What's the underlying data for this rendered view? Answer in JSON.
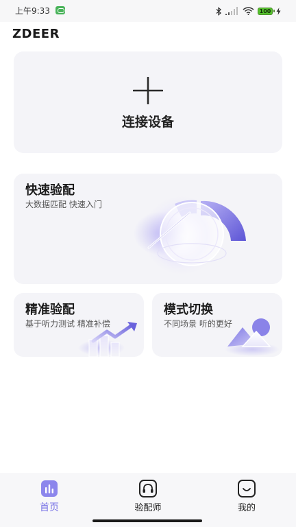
{
  "status_bar": {
    "time": "上午9:33",
    "battery": "100"
  },
  "header": {
    "brand": "ZDEER"
  },
  "connect_card": {
    "label": "连接设备"
  },
  "quick_fit": {
    "title": "快速验配",
    "subtitle": "大数据匹配 快速入门"
  },
  "precise_fit": {
    "title": "精准验配",
    "subtitle": "基于听力测试 精准补偿"
  },
  "mode_switch": {
    "title": "模式切换",
    "subtitle": "不同场景 听的更好"
  },
  "bottom_nav": {
    "items": [
      {
        "label": "首页",
        "icon": "bar-chart-icon",
        "active": true
      },
      {
        "label": "验配师",
        "icon": "headphones-icon",
        "active": false
      },
      {
        "label": "我的",
        "icon": "smile-face-icon",
        "active": false
      }
    ]
  },
  "colors": {
    "accent": "#7a74e6",
    "card_bg": "#f4f4f8",
    "battery_green": "#55c32d"
  }
}
